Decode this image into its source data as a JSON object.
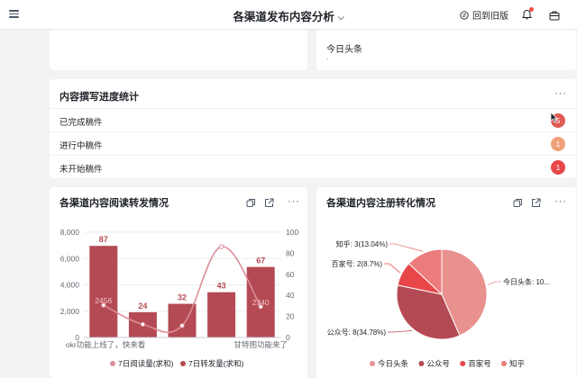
{
  "header": {
    "title": "各渠道发布内容分析",
    "old_version": "回到旧版"
  },
  "top_right_card": {
    "label": "今日头条",
    "value": "-"
  },
  "progress": {
    "title": "内容撰写进度统计",
    "more": "···",
    "rows": [
      {
        "label": "已完成稿件",
        "count": "5",
        "color": "#e05a53"
      },
      {
        "label": "进行中稿件",
        "count": "1",
        "color": "#f0a07a"
      },
      {
        "label": "未开始稿件",
        "count": "1",
        "color": "#e8474a"
      }
    ]
  },
  "read_chart": {
    "title": "各渠道内容阅读转发情况",
    "more": "···"
  },
  "reg_chart": {
    "title": "各渠道内容注册转化情况",
    "more": "···"
  },
  "chart_data": [
    {
      "type": "bar",
      "title": "各渠道内容阅读转发情况",
      "categories": [
        "okr功能上线了，快来看",
        "",
        "",
        "",
        "甘特图功能来了"
      ],
      "series": [
        {
          "name": "7日转发量(求和)",
          "type": "bar",
          "axis": "right",
          "values": [
            87,
            24,
            32,
            43,
            67
          ],
          "color": "#b44a53"
        },
        {
          "name": "7日阅读量(求和)",
          "type": "line",
          "axis": "left",
          "values": [
            2456,
            1000,
            900,
            6900,
            2340
          ],
          "color": "#dc8e99"
        }
      ],
      "value_labels": {
        "read": [
          "2456",
          null,
          null,
          null,
          "2340"
        ]
      },
      "left_axis": {
        "ylim": [
          0,
          8000
        ],
        "ticks": [
          "0",
          "2,000",
          "4,000",
          "6,000",
          "8,000"
        ]
      },
      "right_axis": {
        "ylim": [
          0,
          100
        ],
        "ticks": [
          "0",
          "20",
          "40",
          "60",
          "80",
          "100"
        ]
      },
      "legend": [
        "7日阅读量(求和)",
        "7日转发量(求和)"
      ],
      "legend_position": "bottom"
    },
    {
      "type": "pie",
      "title": "各渠道内容注册转化情况",
      "slices": [
        {
          "name": "今日头条",
          "value": 10,
          "label": "今日头条: 10...",
          "color": "#e8918f"
        },
        {
          "name": "公众号",
          "value": 8,
          "label": "公众号: 8(34.78%)",
          "color": "#b44a53"
        },
        {
          "name": "百家号",
          "value": 2,
          "label": "百家号: 2(8.7%)",
          "color": "#e8474a"
        },
        {
          "name": "知乎",
          "value": 3,
          "label": "知乎: 3(13.04%)",
          "color": "#ec7b7b"
        }
      ],
      "legend": [
        "今日头条",
        "公众号",
        "百家号",
        "知乎"
      ],
      "legend_position": "bottom"
    }
  ]
}
